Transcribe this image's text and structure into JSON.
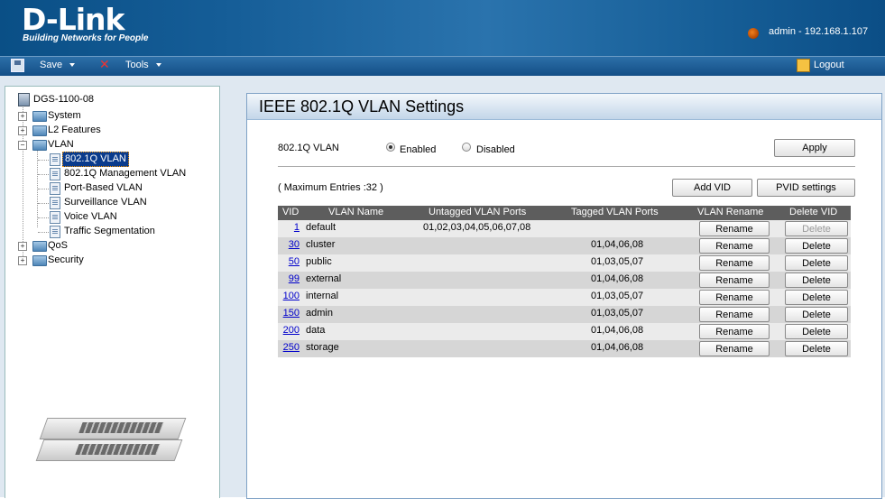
{
  "header": {
    "logo_text": "D-Link",
    "logo_tagline": "Building Networks for People",
    "user_info": "admin - 192.168.1.107"
  },
  "toolbar": {
    "save_label": "Save",
    "tools_label": "Tools",
    "logout_label": "Logout"
  },
  "tree": {
    "root": "DGS-1100-08",
    "items": [
      {
        "label": "System"
      },
      {
        "label": "L2 Features"
      },
      {
        "label": "VLAN"
      },
      {
        "label": "802.1Q VLAN"
      },
      {
        "label": "802.1Q Management VLAN"
      },
      {
        "label": "Port-Based VLAN"
      },
      {
        "label": "Surveillance VLAN"
      },
      {
        "label": "Voice VLAN"
      },
      {
        "label": "Traffic Segmentation"
      },
      {
        "label": "QoS"
      },
      {
        "label": "Security"
      }
    ]
  },
  "main": {
    "title": "IEEE 802.1Q VLAN Settings",
    "vlan_label": "802.1Q VLAN",
    "enabled_label": "Enabled",
    "disabled_label": "Disabled",
    "enabled": true,
    "apply_label": "Apply",
    "max_entries": "( Maximum Entries :32 )",
    "add_vid_label": "Add VID",
    "pvid_settings_label": "PVID settings"
  },
  "table": {
    "headers": [
      "VID",
      "VLAN Name",
      "Untagged VLAN Ports",
      "Tagged VLAN Ports",
      "VLAN Rename",
      "Delete VID"
    ],
    "rows": [
      {
        "vid": "1",
        "name": "default",
        "untagged": "01,02,03,04,05,06,07,08",
        "tagged": "",
        "rename": "Rename",
        "delete": "Delete"
      },
      {
        "vid": "30",
        "name": "cluster",
        "untagged": "",
        "tagged": "01,04,06,08",
        "rename": "Rename",
        "delete": "Delete"
      },
      {
        "vid": "50",
        "name": "public",
        "untagged": "",
        "tagged": "01,03,05,07",
        "rename": "Rename",
        "delete": "Delete"
      },
      {
        "vid": "99",
        "name": "external",
        "untagged": "",
        "tagged": "01,04,06,08",
        "rename": "Rename",
        "delete": "Delete"
      },
      {
        "vid": "100",
        "name": "internal",
        "untagged": "",
        "tagged": "01,03,05,07",
        "rename": "Rename",
        "delete": "Delete"
      },
      {
        "vid": "150",
        "name": "admin",
        "untagged": "",
        "tagged": "01,03,05,07",
        "rename": "Rename",
        "delete": "Delete"
      },
      {
        "vid": "200",
        "name": "data",
        "untagged": "",
        "tagged": "01,04,06,08",
        "rename": "Rename",
        "delete": "Delete"
      },
      {
        "vid": "250",
        "name": "storage",
        "untagged": "",
        "tagged": "01,04,06,08",
        "rename": "Rename",
        "delete": "Delete"
      }
    ]
  }
}
